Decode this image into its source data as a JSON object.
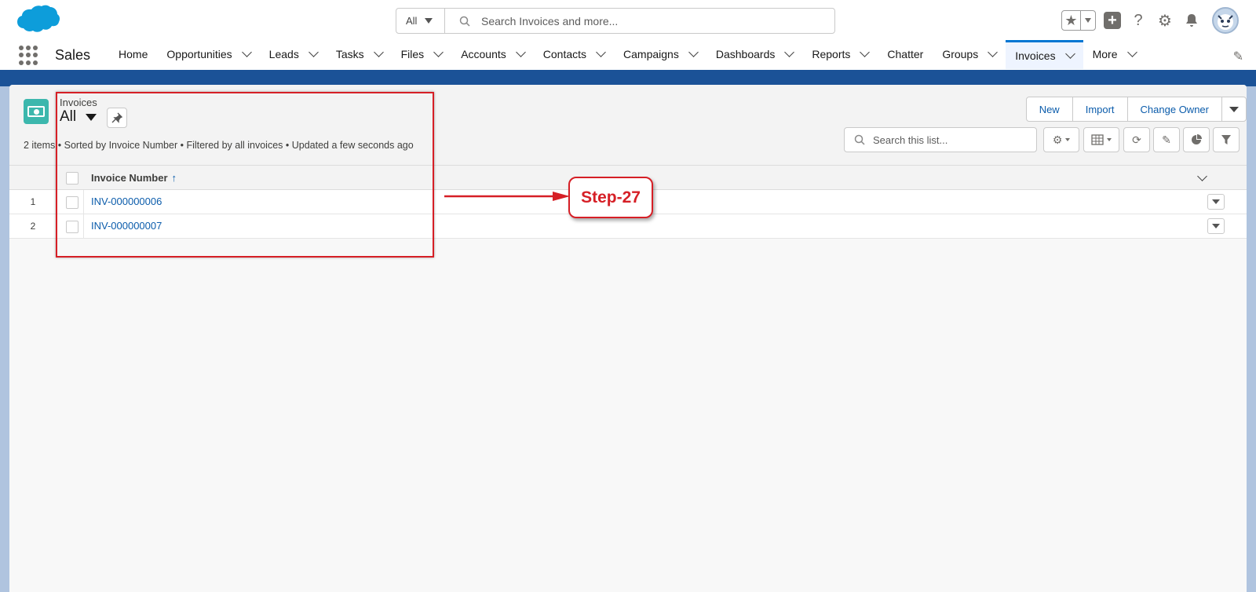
{
  "header": {
    "search_scope": "All",
    "search_placeholder": "Search Invoices and more..."
  },
  "nav": {
    "app_name": "Sales",
    "items": [
      {
        "label": "Home",
        "has_menu": false
      },
      {
        "label": "Opportunities",
        "has_menu": true
      },
      {
        "label": "Leads",
        "has_menu": true
      },
      {
        "label": "Tasks",
        "has_menu": true
      },
      {
        "label": "Files",
        "has_menu": true
      },
      {
        "label": "Accounts",
        "has_menu": true
      },
      {
        "label": "Contacts",
        "has_menu": true
      },
      {
        "label": "Campaigns",
        "has_menu": true
      },
      {
        "label": "Dashboards",
        "has_menu": true
      },
      {
        "label": "Reports",
        "has_menu": true
      },
      {
        "label": "Chatter",
        "has_menu": false
      },
      {
        "label": "Groups",
        "has_menu": true
      },
      {
        "label": "Invoices",
        "has_menu": true,
        "active": true
      },
      {
        "label": "More",
        "has_menu": true
      }
    ]
  },
  "list_view": {
    "object_label": "Invoices",
    "list_name": "All",
    "summary": "2 items • Sorted by Invoice Number • Filtered by all invoices • Updated a few seconds ago",
    "actions": [
      "New",
      "Import",
      "Change Owner"
    ],
    "search_placeholder": "Search this list...",
    "column_header": "Invoice Number",
    "sort_arrow": "↑",
    "rows": [
      {
        "num": "1",
        "invoice_number": "INV-000000006"
      },
      {
        "num": "2",
        "invoice_number": "INV-000000007"
      }
    ]
  },
  "annotation": {
    "step_label": "Step-27",
    "color": "#d61f26"
  },
  "colors": {
    "brand_blue": "#0176d3",
    "link": "#0b5cab",
    "object_icon": "#3cb7ad",
    "band": "#1b5297"
  }
}
